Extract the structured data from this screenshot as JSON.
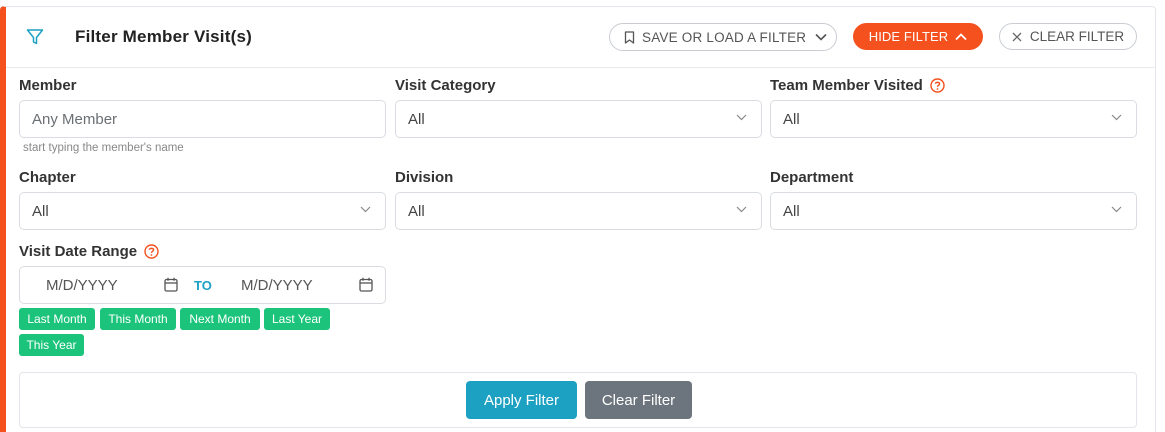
{
  "header": {
    "title": "Filter Member Visit(s)",
    "save_load_label": "SAVE OR LOAD A FILTER",
    "hide_filter_label": "HIDE FILTER",
    "clear_filter_label": "CLEAR FILTER",
    "filter_icon": "filter-funnel-icon",
    "bookmark_icon": "bookmark-icon",
    "chevron_icon": "chevron-down-icon",
    "chevron_up_icon": "chevron-up-icon",
    "close_icon": "close-icon"
  },
  "fields": {
    "member": {
      "label": "Member",
      "placeholder": "Any Member",
      "hint": "start typing the member's name"
    },
    "visit_category": {
      "label": "Visit Category",
      "value": "All"
    },
    "team_member_visited": {
      "label": "Team Member Visited",
      "value": "All"
    },
    "chapter": {
      "label": "Chapter",
      "value": "All"
    },
    "division": {
      "label": "Division",
      "value": "All"
    },
    "department": {
      "label": "Department",
      "value": "All"
    },
    "visit_date_range": {
      "label": "Visit Date Range",
      "from_placeholder": "M/D/YYYY",
      "to_label": "TO",
      "to_placeholder": "M/D/YYYY"
    }
  },
  "quick_ranges": [
    "Last Month",
    "This Month",
    "Next Month",
    "Last Year",
    "This Year"
  ],
  "footer": {
    "apply_label": "Apply Filter",
    "clear_label": "Clear Filter"
  },
  "colors": {
    "accent": "#f4511e",
    "teal": "#1da1c2",
    "chip_green": "#1cc47b",
    "gray_button": "#6c757d"
  }
}
